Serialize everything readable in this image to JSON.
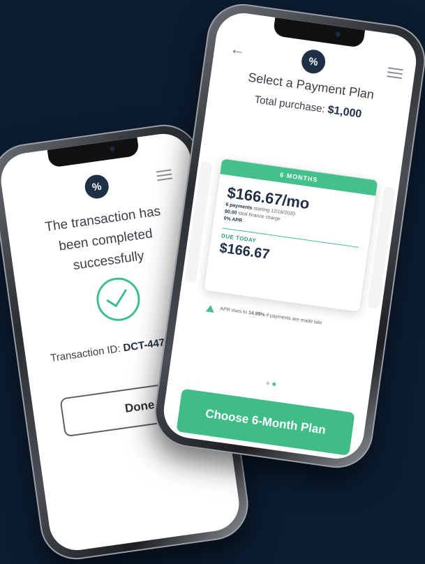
{
  "colors": {
    "background": "#0b1c30",
    "accent": "#43c08c",
    "navy": "#1f2f45"
  },
  "icons": {
    "logo": "percent-logo-icon",
    "menu": "hamburger-menu-icon",
    "back": "back-arrow-icon",
    "check": "checkmark-circle-icon",
    "warning": "warning-triangle-icon"
  },
  "left_phone": {
    "logo_text": "%",
    "title": "The transaction has been completed successfully",
    "transaction_label": "Transaction ID:",
    "transaction_id": "DCT-447",
    "done_button": "Done"
  },
  "right_phone": {
    "logo_text": "%",
    "back_arrow": "←",
    "title": "Select a Payment Plan",
    "total_label": "Total purchase:",
    "total_value": "$1,000",
    "card": {
      "header": "6 MONTHS",
      "monthly_price": "$166.67/mo",
      "payments_bold": "6 payments",
      "payments_text": "starting 12/16/2020",
      "finance_bold": "$0.00",
      "finance_text": "total finance charge",
      "apr": "0% APR",
      "due_label": "DUE TODAY",
      "due_amount": "$166.67"
    },
    "apr_note_pre": "APR rises to",
    "apr_note_bold": "14.99%",
    "apr_note_post": "if payments are made late.",
    "carousel": {
      "count": 2,
      "active_index": 1
    },
    "cta_button": "Choose 6-Month Plan"
  }
}
